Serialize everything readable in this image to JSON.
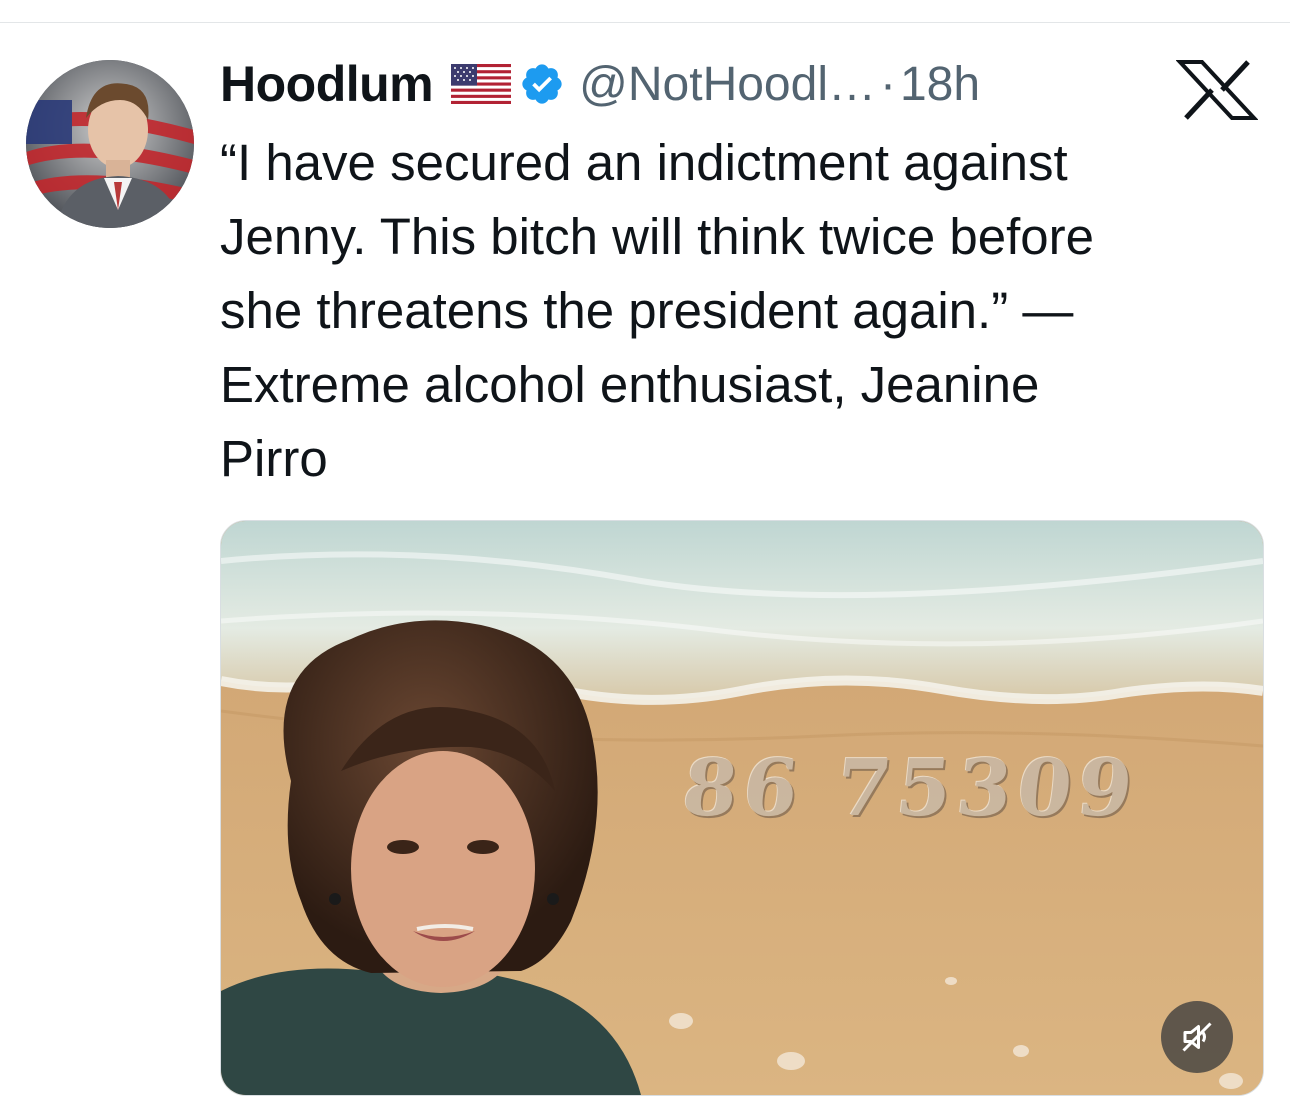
{
  "post": {
    "author": {
      "display_name": "Hoodlum",
      "handle": "@NotHoodl…",
      "flag_icon": "us-flag-icon",
      "verified_icon": "verified-badge-icon",
      "verified_color": "#1d9bf0"
    },
    "separator": "·",
    "timestamp": "18h",
    "text": "“I have secured an indictment against\nJenny. This bitch will think twice before\nshe threatens the president again.” —\nExtreme alcohol enthusiast, Jeanine\nPirro",
    "platform_icon": "x-logo-icon",
    "media": {
      "type": "image",
      "overlay_text": "86 75309",
      "mute_icon": "speaker-muted-icon"
    }
  },
  "colors": {
    "text_primary": "#0f1419",
    "text_secondary": "#536471",
    "accent_blue": "#1d9bf0"
  }
}
